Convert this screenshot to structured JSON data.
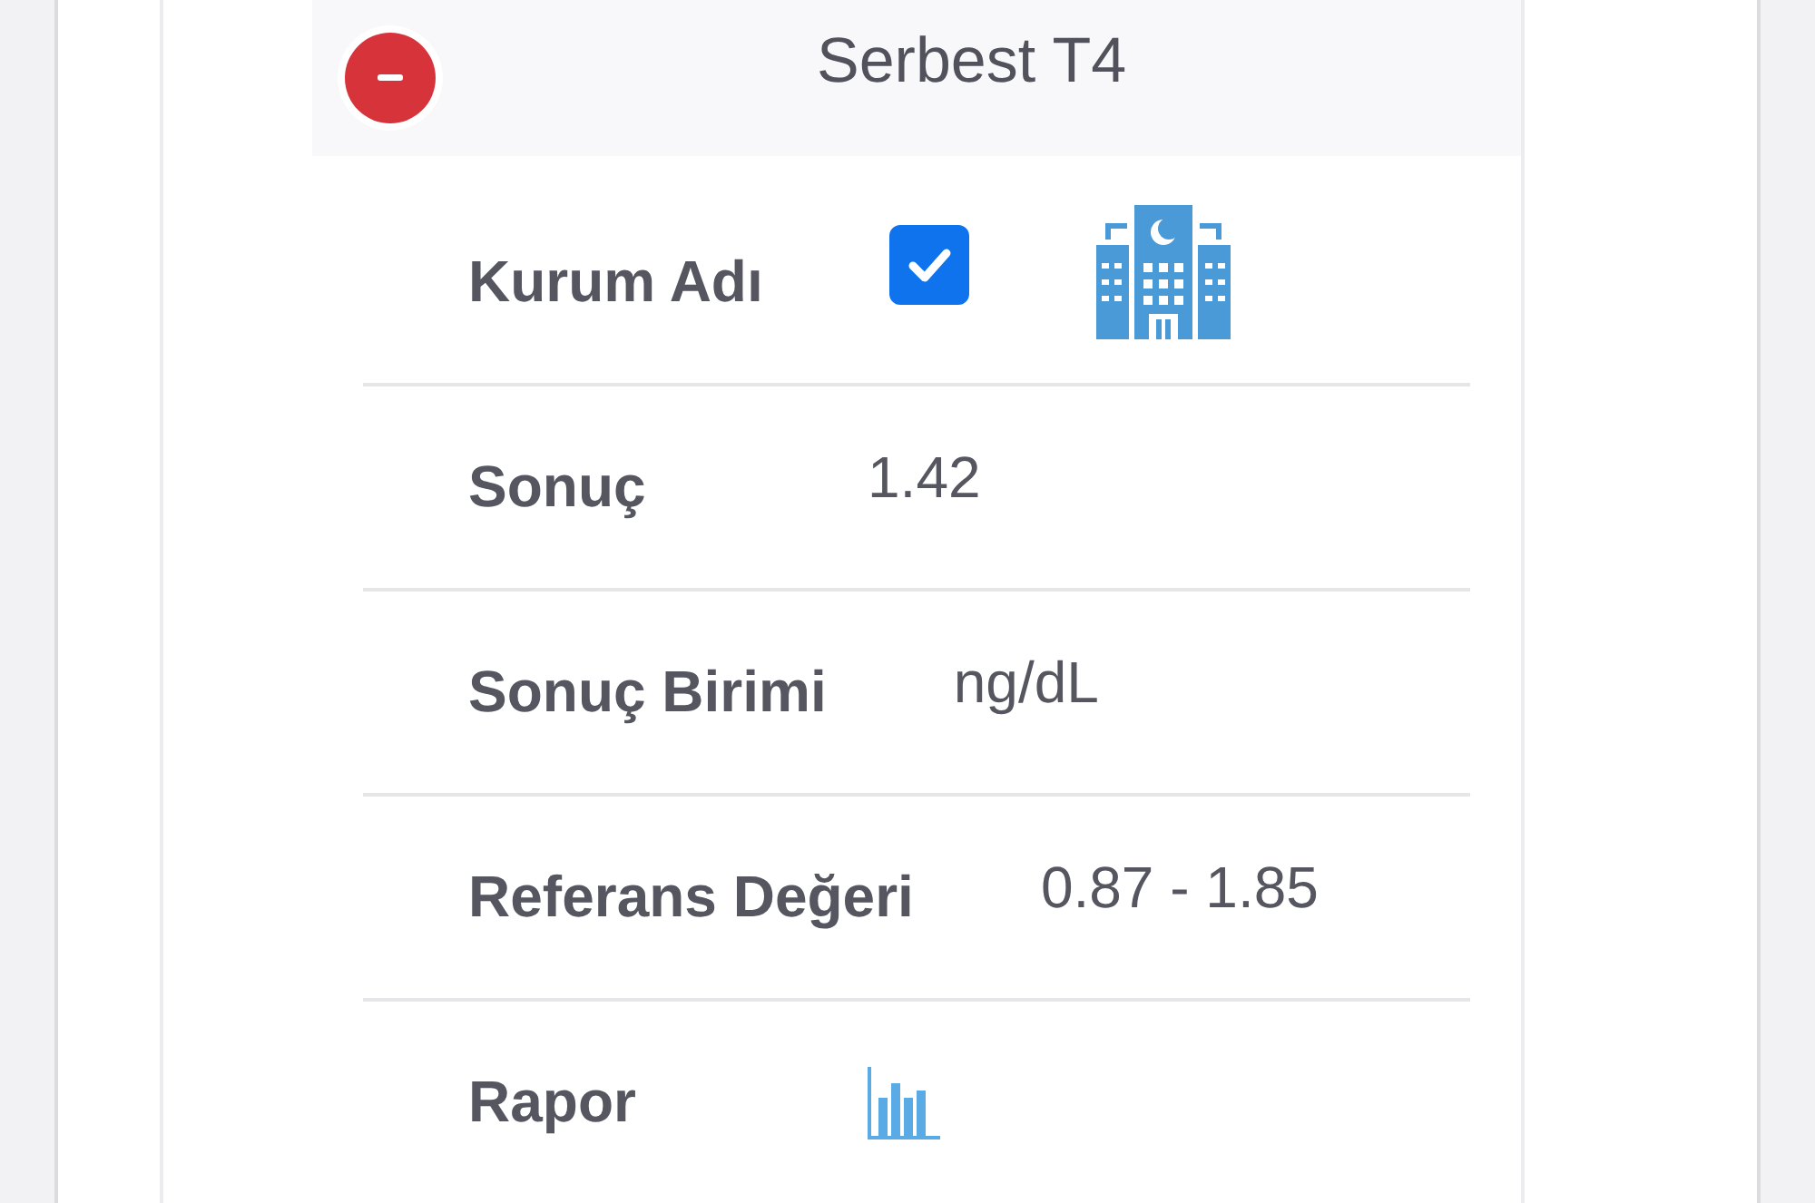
{
  "section": {
    "title": "Serbest T4",
    "expanded": true
  },
  "rows": [
    {
      "kind": "checkbox",
      "label": "Kurum Adı",
      "checked": true
    },
    {
      "kind": "value",
      "label": "Sonuç",
      "value": "1.42"
    },
    {
      "kind": "value",
      "label": "Sonuç Birimi",
      "value": "ng/dL"
    },
    {
      "kind": "value",
      "label": "Referans Değeri",
      "value": "0.87 - 1.85"
    },
    {
      "kind": "report",
      "label": "Rapor"
    }
  ]
}
